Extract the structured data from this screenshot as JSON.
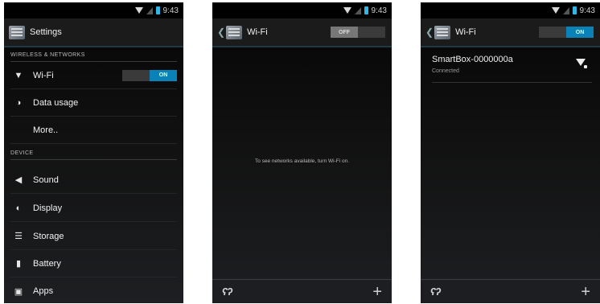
{
  "status_bar": {
    "time": "9:43"
  },
  "screen1": {
    "title": "Settings",
    "sections": {
      "wireless": "WIRELESS & NETWORKS",
      "device": "DEVICE"
    },
    "items": {
      "wifi": {
        "label": "Wi-Fi",
        "icon": "wifi-icon",
        "toggle_on": "ON",
        "toggle_off": ""
      },
      "data_usage": {
        "label": "Data usage",
        "icon": "data-usage-icon"
      },
      "more": {
        "label": "More.."
      },
      "sound": {
        "label": "Sound",
        "icon": "speaker-icon"
      },
      "display": {
        "label": "Display",
        "icon": "brightness-icon"
      },
      "storage": {
        "label": "Storage",
        "icon": "storage-icon"
      },
      "battery": {
        "label": "Battery",
        "icon": "battery-icon"
      },
      "apps": {
        "label": "Apps",
        "icon": "apps-icon"
      }
    }
  },
  "screen2": {
    "title": "Wi-Fi",
    "toggle": {
      "off_label": "OFF",
      "state": "off"
    },
    "message": "To see networks available, turn Wi-Fi on."
  },
  "screen3": {
    "title": "Wi-Fi",
    "toggle": {
      "on_label": "ON",
      "state": "on"
    },
    "network": {
      "name": "SmartBox-0000000a",
      "status": "Connected"
    }
  },
  "colors": {
    "accent": "#33b5e5",
    "toggle_on": "#0a82b7",
    "background": "#111111"
  }
}
